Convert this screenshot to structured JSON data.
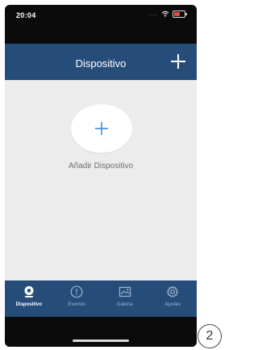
{
  "status_bar": {
    "time": "20:04",
    "signal_dots": "....",
    "battery_level": 0.58,
    "battery_color": "#e34b3f"
  },
  "header": {
    "title": "Dispositivo",
    "add_icon": "plus-icon"
  },
  "main": {
    "add_device_icon": "plus-icon",
    "add_device_label": "Añadir Dispositivo"
  },
  "tabbar": {
    "tabs": [
      {
        "label": "Dispositivo",
        "icon": "camera-icon",
        "active": true
      },
      {
        "label": "Eventos",
        "icon": "alert-icon",
        "active": false
      },
      {
        "label": "Galería",
        "icon": "image-icon",
        "active": false
      },
      {
        "label": "Ajustes",
        "icon": "gear-icon",
        "active": false
      }
    ]
  },
  "page_number": "2",
  "colors": {
    "brand_blue": "#264d79",
    "accent_blue": "#3a8fd9",
    "background": "#ececec"
  }
}
